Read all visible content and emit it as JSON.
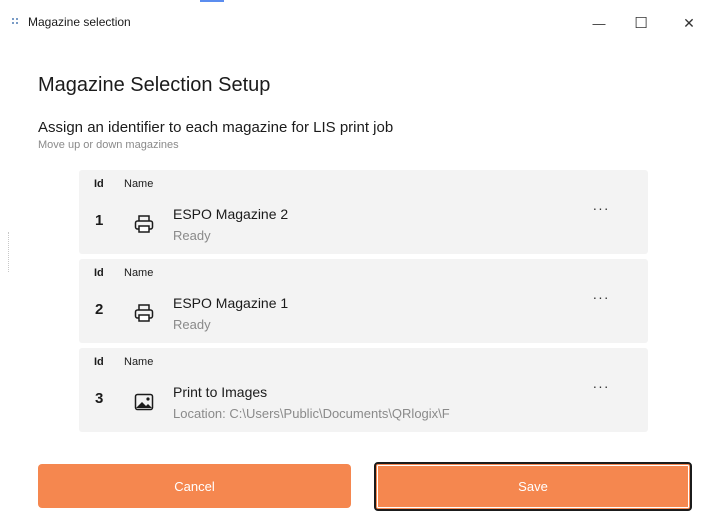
{
  "window": {
    "title": "Magazine selection",
    "minimize_glyph": "—",
    "maximize_glyph": "☐",
    "close_glyph": "✕"
  },
  "page": {
    "title": "Magazine Selection Setup",
    "subtitle": "Assign an identifier to each magazine for LIS print job",
    "hint": "Move up or down magazines"
  },
  "magazines": [
    {
      "id_header": "Id",
      "name_header": "Name",
      "id": "1",
      "icon": "printer-icon",
      "name": "ESPO Magazine 2",
      "status": "Ready",
      "more": "···"
    },
    {
      "id_header": "Id",
      "name_header": "Name",
      "id": "2",
      "icon": "printer-icon",
      "name": "ESPO Magazine 1",
      "status": "Ready",
      "more": "···"
    },
    {
      "id_header": "Id",
      "name_header": "Name",
      "id": "3",
      "icon": "image-icon",
      "name": "Print to Images",
      "status": "Location: C:\\Users\\Public\\Documents\\QRlogix\\F",
      "more": "···"
    }
  ],
  "buttons": {
    "cancel": "Cancel",
    "save": "Save"
  },
  "colors": {
    "accent": "#f5874f",
    "card_background": "#f3f3f3",
    "muted_text": "#8a8a8a"
  }
}
